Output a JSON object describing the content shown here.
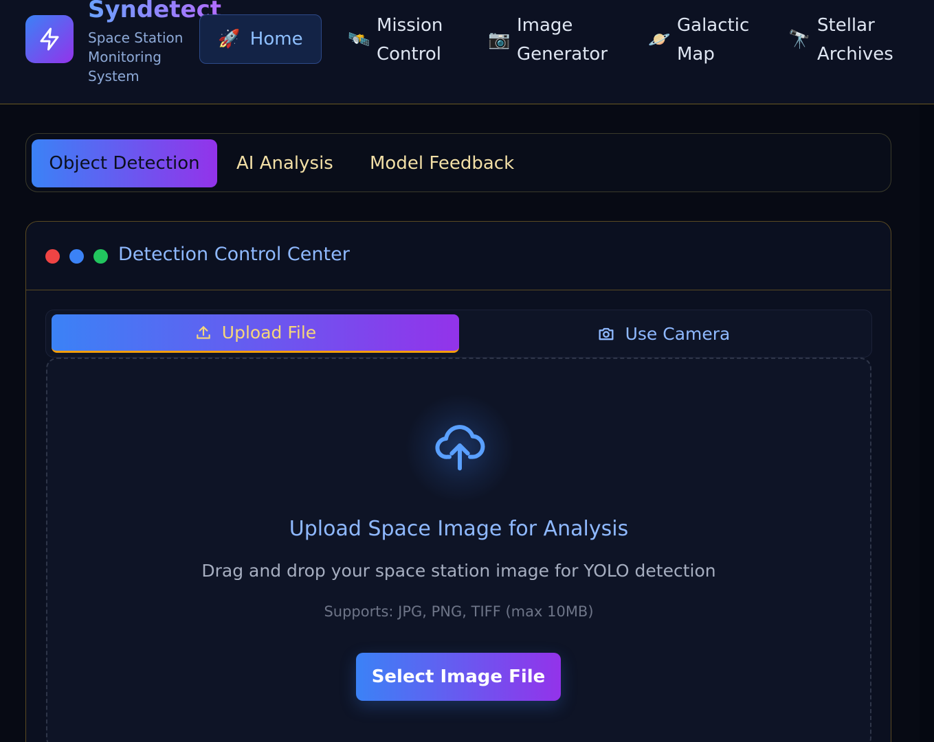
{
  "brand": {
    "name": "Syndetect",
    "subtitle": "Space Station Monitoring System",
    "logo_icon": "lightning-bolt-icon"
  },
  "nav": {
    "home": {
      "emoji": "🚀",
      "label": "Home"
    },
    "items": [
      {
        "emoji": "🛰️",
        "label": "Mission Control"
      },
      {
        "emoji": "📷",
        "label": "Image Generator"
      },
      {
        "emoji": "🪐",
        "label": "Galactic Map"
      },
      {
        "emoji": "🔭",
        "label": "Stellar Archives"
      }
    ]
  },
  "tabs": {
    "active": "Object Detection",
    "items": [
      "AI Analysis",
      "Model Feedback"
    ]
  },
  "panel": {
    "title": "Detection Control Center",
    "dot_colors": [
      "#ef4444",
      "#3b82f6",
      "#22c55e"
    ],
    "modes": {
      "upload": "Upload File",
      "camera": "Use Camera"
    },
    "dropzone": {
      "title": "Upload Space Image for Analysis",
      "description": "Drag and drop your space station image for YOLO detection",
      "supports": "Supports: JPG, PNG, TIFF (max 10MB)",
      "button": "Select Image File"
    }
  },
  "colors": {
    "accent_start": "#3b82f6",
    "accent_end": "#9333ea",
    "gold": "#f59e0b"
  }
}
